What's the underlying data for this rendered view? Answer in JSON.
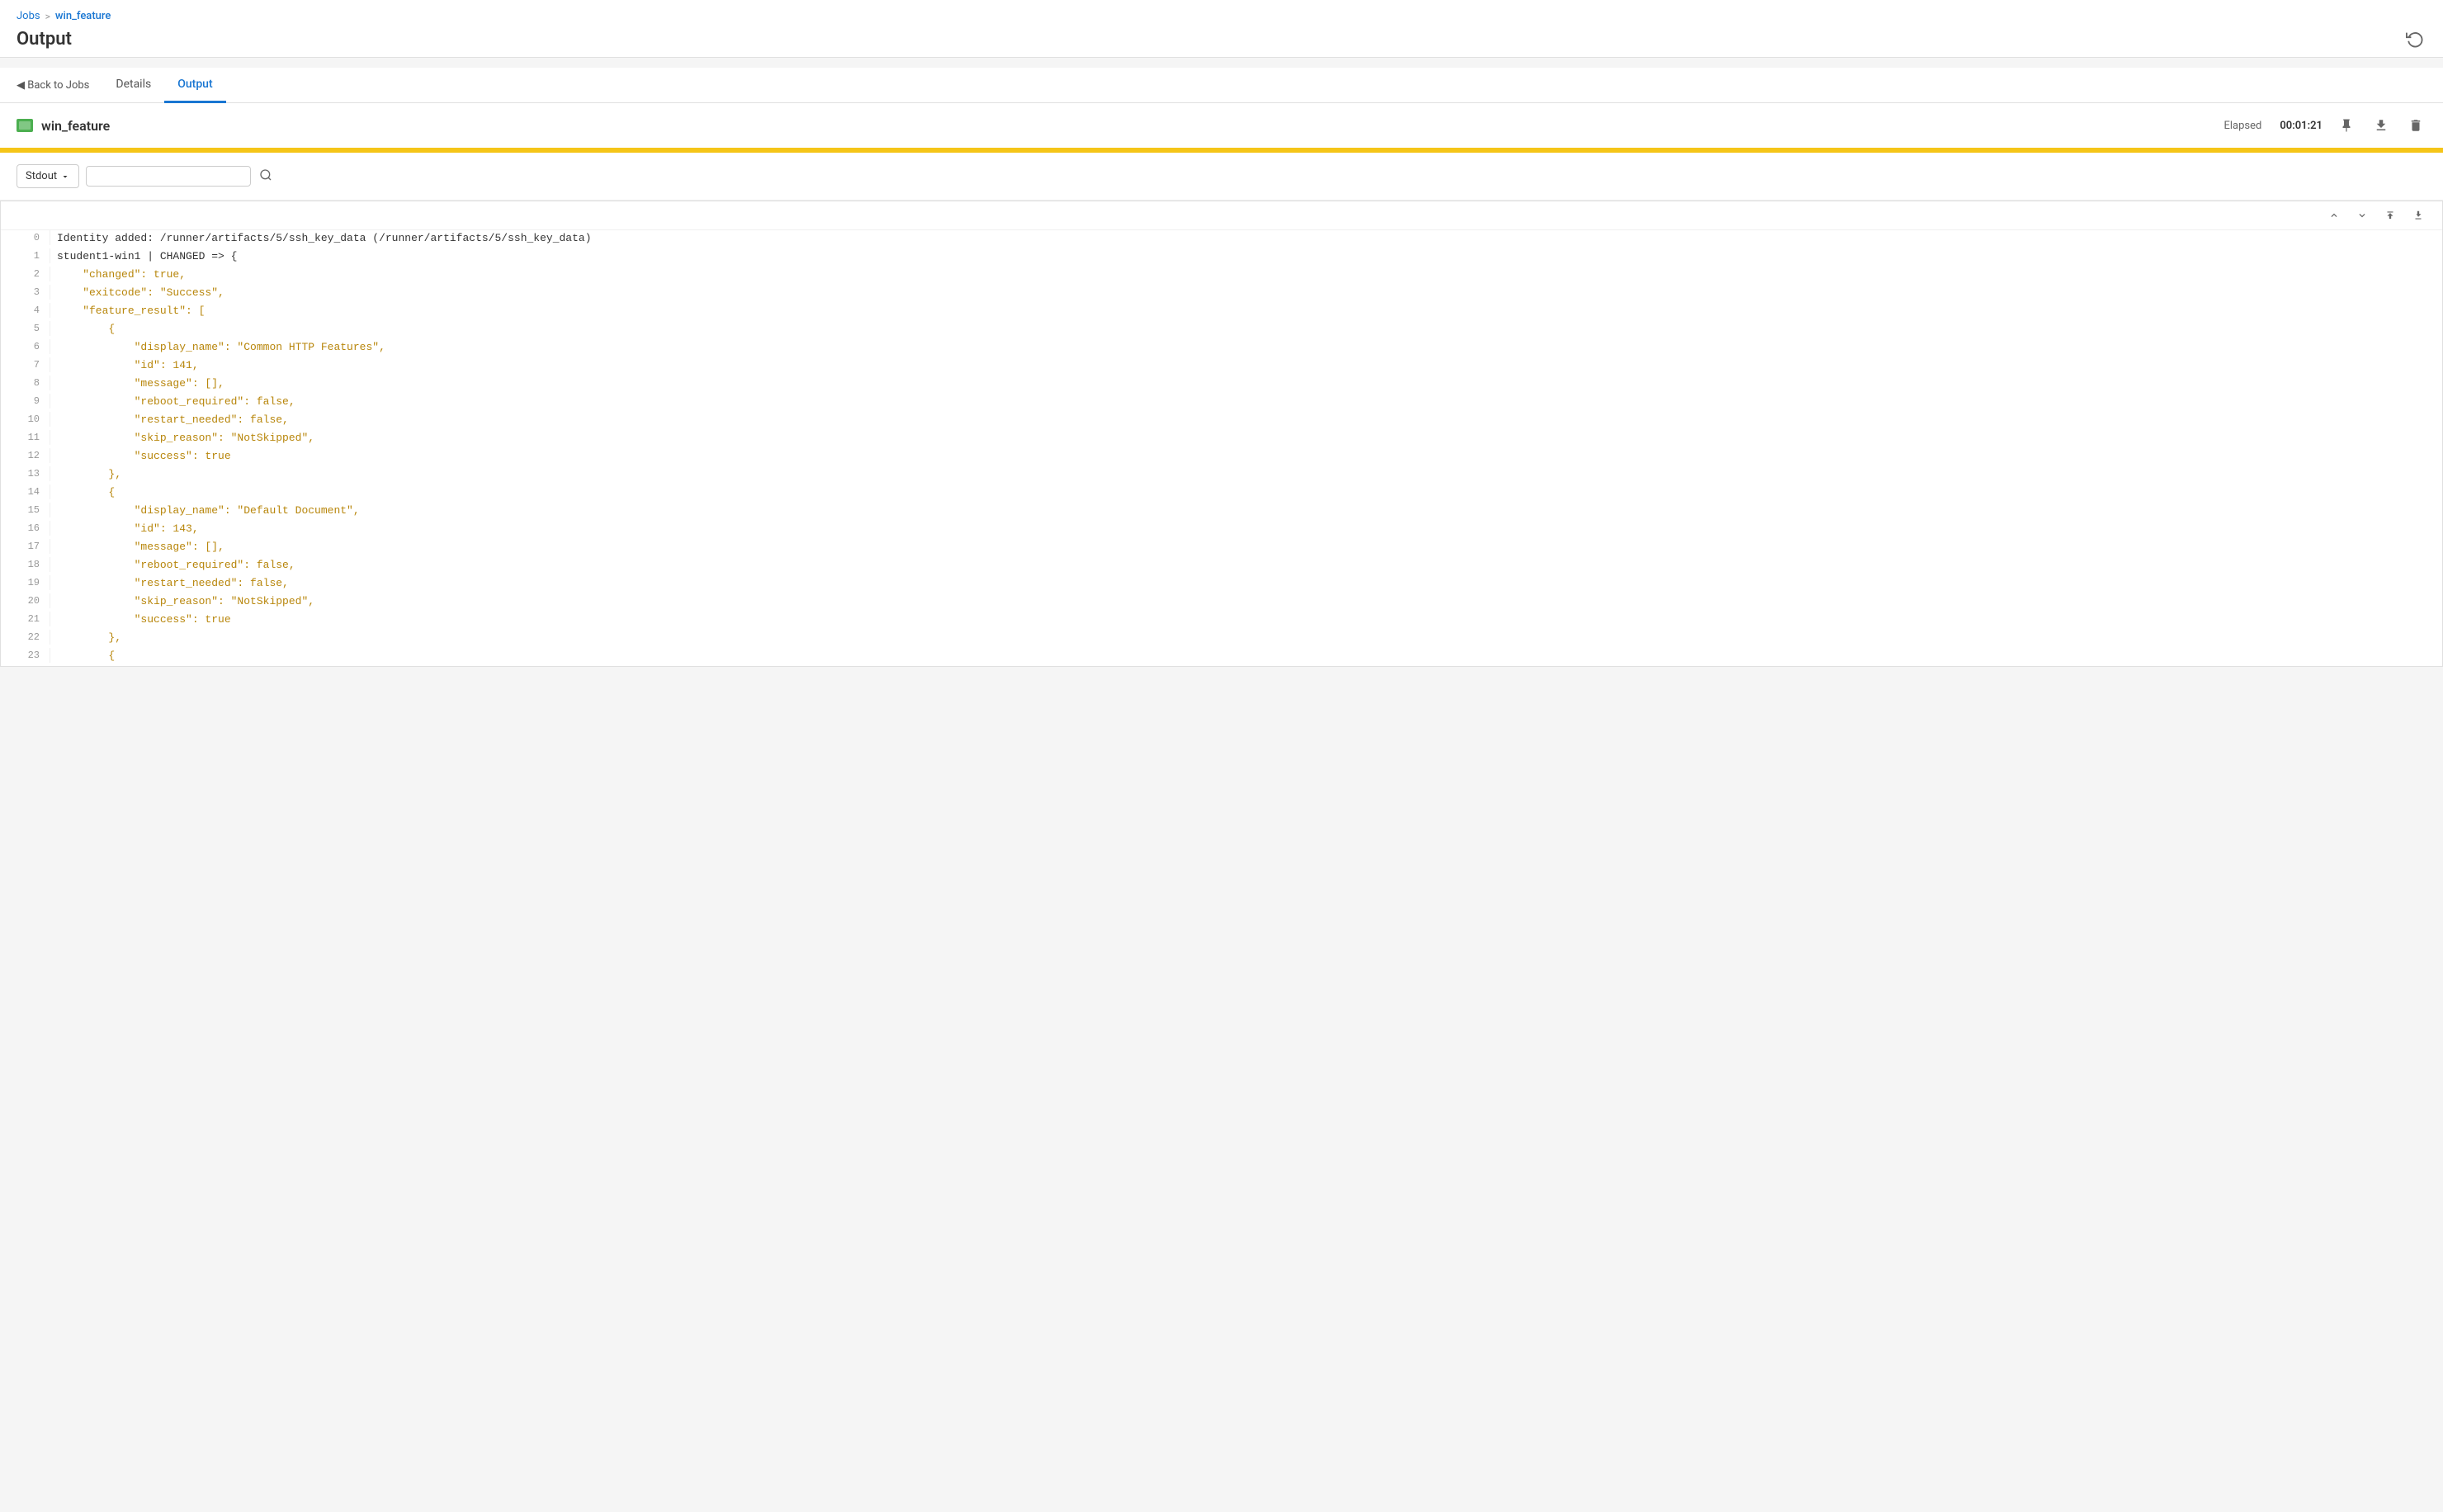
{
  "breadcrumb": {
    "jobs_label": "Jobs",
    "separator": ">",
    "current_label": "win_feature"
  },
  "page": {
    "title": "Output",
    "history_icon": "↺"
  },
  "tabs": {
    "back_label": "◀ Back to Jobs",
    "items": [
      {
        "label": "Details",
        "active": false
      },
      {
        "label": "Output",
        "active": true
      }
    ]
  },
  "job": {
    "name": "win_feature",
    "elapsed_label": "Elapsed",
    "elapsed_time": "00:01:21",
    "pin_icon": "📌",
    "download_icon": "⬇",
    "delete_icon": "🗑"
  },
  "controls": {
    "stdout_label": "Stdout",
    "search_placeholder": ""
  },
  "nav_buttons": {
    "up": "∧",
    "down": "∨",
    "top": "⋀",
    "bottom": "⋁"
  },
  "code_lines": [
    {
      "num": 0,
      "text": "Identity added: /runner/artifacts/5/ssh_key_data (/runner/artifacts/5/ssh_key_data)",
      "style": "white"
    },
    {
      "num": 1,
      "text": "student1-win1 | CHANGED => {",
      "style": "white"
    },
    {
      "num": 2,
      "text": "    \"changed\": true,",
      "style": "yellow"
    },
    {
      "num": 3,
      "text": "    \"exitcode\": \"Success\",",
      "style": "yellow"
    },
    {
      "num": 4,
      "text": "    \"feature_result\": [",
      "style": "yellow"
    },
    {
      "num": 5,
      "text": "        {",
      "style": "yellow"
    },
    {
      "num": 6,
      "text": "            \"display_name\": \"Common HTTP Features\",",
      "style": "yellow"
    },
    {
      "num": 7,
      "text": "            \"id\": 141,",
      "style": "yellow"
    },
    {
      "num": 8,
      "text": "            \"message\": [],",
      "style": "yellow"
    },
    {
      "num": 9,
      "text": "            \"reboot_required\": false,",
      "style": "yellow"
    },
    {
      "num": 10,
      "text": "            \"restart_needed\": false,",
      "style": "yellow"
    },
    {
      "num": 11,
      "text": "            \"skip_reason\": \"NotSkipped\",",
      "style": "yellow"
    },
    {
      "num": 12,
      "text": "            \"success\": true",
      "style": "yellow"
    },
    {
      "num": 13,
      "text": "        },",
      "style": "yellow"
    },
    {
      "num": 14,
      "text": "        {",
      "style": "yellow"
    },
    {
      "num": 15,
      "text": "            \"display_name\": \"Default Document\",",
      "style": "yellow"
    },
    {
      "num": 16,
      "text": "            \"id\": 143,",
      "style": "yellow"
    },
    {
      "num": 17,
      "text": "            \"message\": [],",
      "style": "yellow"
    },
    {
      "num": 18,
      "text": "            \"reboot_required\": false,",
      "style": "yellow"
    },
    {
      "num": 19,
      "text": "            \"restart_needed\": false,",
      "style": "yellow"
    },
    {
      "num": 20,
      "text": "            \"skip_reason\": \"NotSkipped\",",
      "style": "yellow"
    },
    {
      "num": 21,
      "text": "            \"success\": true",
      "style": "yellow"
    },
    {
      "num": 22,
      "text": "        },",
      "style": "yellow"
    },
    {
      "num": 23,
      "text": "        {",
      "style": "yellow"
    }
  ],
  "colors": {
    "accent": "#1976d2",
    "progress": "#f5c518",
    "job_icon": "#4caf50"
  }
}
